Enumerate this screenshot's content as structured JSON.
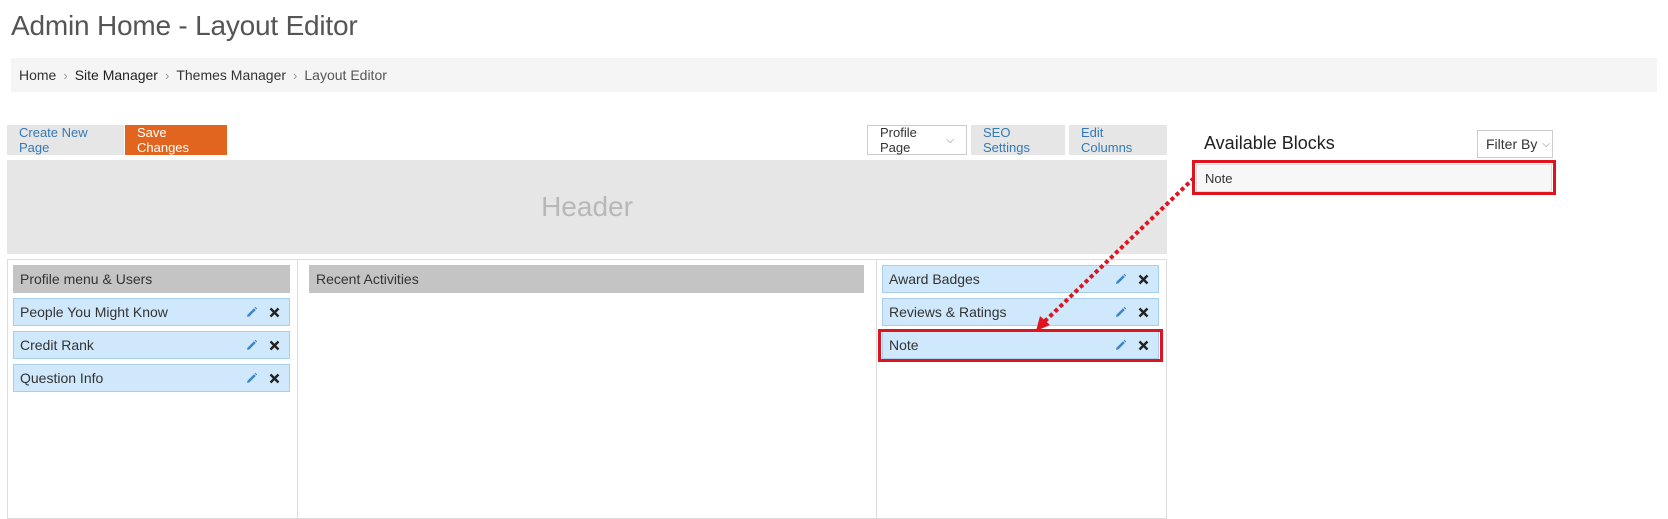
{
  "page": {
    "title": "Admin Home - Layout Editor"
  },
  "breadcrumb": {
    "items": [
      "Home",
      "Site Manager",
      "Themes Manager",
      "Layout Editor"
    ],
    "separator": "›"
  },
  "toolbar": {
    "create_new_page": "Create New Page",
    "save_changes": "Save Changes",
    "page_select": "Profile Page",
    "seo_settings": "SEO Settings",
    "edit_columns": "Edit Columns"
  },
  "layout": {
    "header_label": "Header",
    "left_column": {
      "title": "Profile menu & Users",
      "blocks": [
        "People You Might Know",
        "Credit Rank",
        "Question Info"
      ]
    },
    "middle_column": {
      "title": "Recent Activities"
    },
    "right_column": {
      "blocks": [
        "Award Badges",
        "Reviews & Ratings",
        "Note"
      ]
    }
  },
  "available_blocks": {
    "title": "Available Blocks",
    "filter_label": "Filter By",
    "items": [
      "Note"
    ]
  },
  "icons": {
    "edit": "pencil-icon",
    "remove": "close-icon",
    "dropdown": "chevron-down-icon",
    "crumb_separator": "chevron-right-icon"
  },
  "colors": {
    "accent_orange": "#e2651f",
    "link_blue": "#337ab7",
    "block_blue": "#cfe8fb",
    "highlight_red": "#e0141e"
  }
}
